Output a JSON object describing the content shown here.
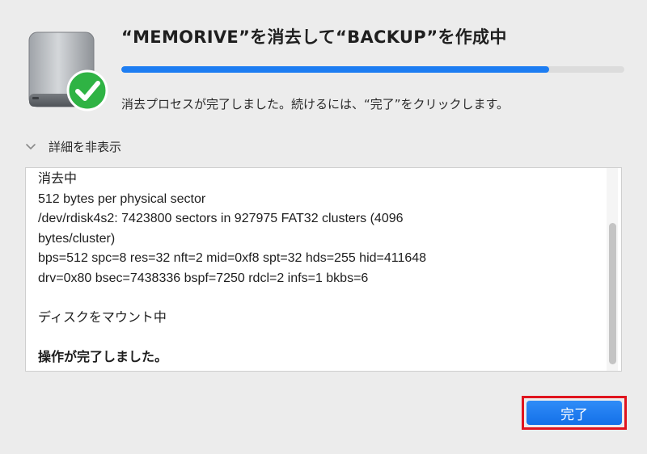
{
  "dialog": {
    "title": "“MEMORIVE”を消去して“BACKUP”を作成中",
    "progress": 0.85,
    "status_text": "消去プロセスが完了しました。続けるには、“完了”をクリックします。",
    "details_toggle_label": "詳細を非表示",
    "log_lines": [
      "消去中",
      "512 bytes per physical sector",
      "/dev/rdisk4s2: 7423800 sectors in 927975 FAT32 clusters (4096",
      "bytes/cluster)",
      "bps=512 spc=8 res=32 nft=2 mid=0xf8 spt=32 hds=255 hid=411648",
      "drv=0x80 bsec=7438336 bspf=7250 rdcl=2 infs=1 bkbs=6",
      "",
      "ディスクをマウント中",
      "",
      "操作が完了しました。"
    ],
    "done_button_label": "完了",
    "icons": {
      "drive": "external-drive-icon",
      "badge": "checkmark-badge-icon",
      "toggle": "chevron-down-icon"
    },
    "colors": {
      "accent": "#1d7df2",
      "success": "#2fb344",
      "highlight": "#e0141e"
    }
  }
}
